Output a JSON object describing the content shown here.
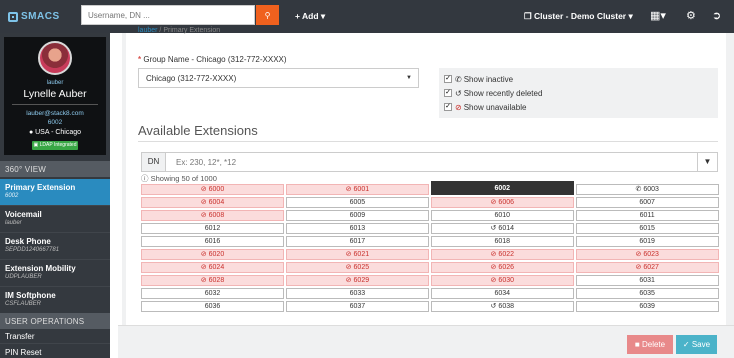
{
  "header": {
    "logo": "SMACS",
    "search_placeholder": "Username, DN ...",
    "add_label": "+ Add",
    "cluster_label": "Cluster - Demo Cluster"
  },
  "profile": {
    "username": "lauber",
    "name": "Lynelle Auber",
    "email": "lauber@stack8.com",
    "extension": "6002",
    "location": "USA - Chicago",
    "badge": "LDAP Integrated"
  },
  "sidebar": {
    "section_360": "360° VIEW",
    "items": [
      {
        "title": "Primary Extension",
        "sub": "6002"
      },
      {
        "title": "Voicemail",
        "sub": "lauber"
      },
      {
        "title": "Desk Phone",
        "sub": "SEPDD1240667781"
      },
      {
        "title": "Extension Mobility",
        "sub": "UDPLAUBER"
      },
      {
        "title": "IM Softphone",
        "sub": "CSFLAUBER"
      }
    ],
    "section_ops": "USER OPERATIONS",
    "ops": [
      "Transfer",
      "PIN Reset"
    ]
  },
  "breadcrumb": {
    "user": "lauber",
    "page": "Primary Extension"
  },
  "form": {
    "group_label": "Group Name - Chicago (312-772-XXXX)",
    "group_value": "Chicago (312-772-XXXX)",
    "checks": [
      {
        "label": "Show inactive",
        "icon": "phone-slash-icon"
      },
      {
        "label": "Show recently deleted",
        "icon": "history-icon"
      },
      {
        "label": "Show unavailable",
        "icon": "ban-icon"
      }
    ]
  },
  "extensions": {
    "title": "Available Extensions",
    "filter_label": "DN",
    "filter_placeholder": "Ex: 230, 12*, *12",
    "showing": "Showing 50 of 1000",
    "cells": [
      {
        "n": "6000",
        "s": "unavailable"
      },
      {
        "n": "6001",
        "s": "unavailable"
      },
      {
        "n": "6002",
        "s": "selected"
      },
      {
        "n": "6003",
        "s": "inactive"
      },
      {
        "n": "6004",
        "s": "unavailable"
      },
      {
        "n": "6005",
        "s": "available"
      },
      {
        "n": "6006",
        "s": "unavailable"
      },
      {
        "n": "6007",
        "s": "available"
      },
      {
        "n": "6008",
        "s": "unavailable"
      },
      {
        "n": "6009",
        "s": "available"
      },
      {
        "n": "6010",
        "s": "available"
      },
      {
        "n": "6011",
        "s": "available"
      },
      {
        "n": "6012",
        "s": "available"
      },
      {
        "n": "6013",
        "s": "available"
      },
      {
        "n": "6014",
        "s": "deleted"
      },
      {
        "n": "6015",
        "s": "available"
      },
      {
        "n": "6016",
        "s": "available"
      },
      {
        "n": "6017",
        "s": "available"
      },
      {
        "n": "6018",
        "s": "available"
      },
      {
        "n": "6019",
        "s": "available"
      },
      {
        "n": "6020",
        "s": "unavailable"
      },
      {
        "n": "6021",
        "s": "unavailable"
      },
      {
        "n": "6022",
        "s": "unavailable"
      },
      {
        "n": "6023",
        "s": "unavailable"
      },
      {
        "n": "6024",
        "s": "unavailable"
      },
      {
        "n": "6025",
        "s": "unavailable"
      },
      {
        "n": "6026",
        "s": "unavailable"
      },
      {
        "n": "6027",
        "s": "unavailable"
      },
      {
        "n": "6028",
        "s": "unavailable"
      },
      {
        "n": "6029",
        "s": "unavailable"
      },
      {
        "n": "6030",
        "s": "unavailable"
      },
      {
        "n": "6031",
        "s": "available"
      },
      {
        "n": "6032",
        "s": "available"
      },
      {
        "n": "6033",
        "s": "available"
      },
      {
        "n": "6034",
        "s": "available"
      },
      {
        "n": "6035",
        "s": "available"
      },
      {
        "n": "6036",
        "s": "available"
      },
      {
        "n": "6037",
        "s": "available"
      },
      {
        "n": "6038",
        "s": "deleted"
      },
      {
        "n": "6039",
        "s": "available"
      }
    ]
  },
  "actions": {
    "delete": "Delete",
    "save": "Save"
  },
  "colors": {
    "accent": "#2a8bbf",
    "danger": "#c9302c",
    "search_btn": "#f0611e",
    "save": "#4bb3c9"
  }
}
